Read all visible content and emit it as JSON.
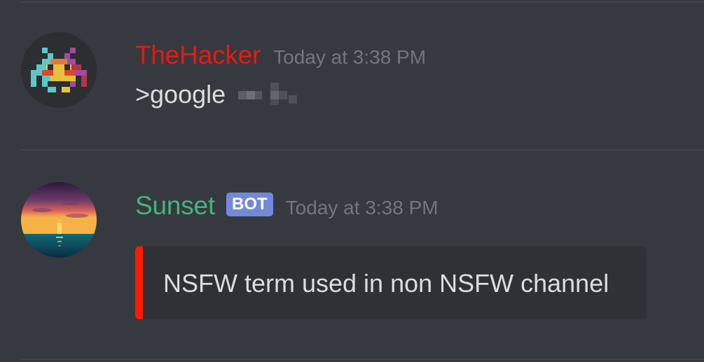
{
  "messages": [
    {
      "username": "TheHacker",
      "timestamp": "Today at 3:38 PM",
      "content": ">google",
      "avatar_icon": "space-invader-icon",
      "username_color": "#e9190f"
    },
    {
      "username": "Sunset",
      "badge": "BOT",
      "timestamp": "Today at 3:38 PM",
      "avatar_icon": "sunset-icon",
      "username_color": "#43b581",
      "embed": {
        "text": "NSFW term used in non NSFW channel",
        "accent_color": "#ff1a00"
      }
    }
  ]
}
